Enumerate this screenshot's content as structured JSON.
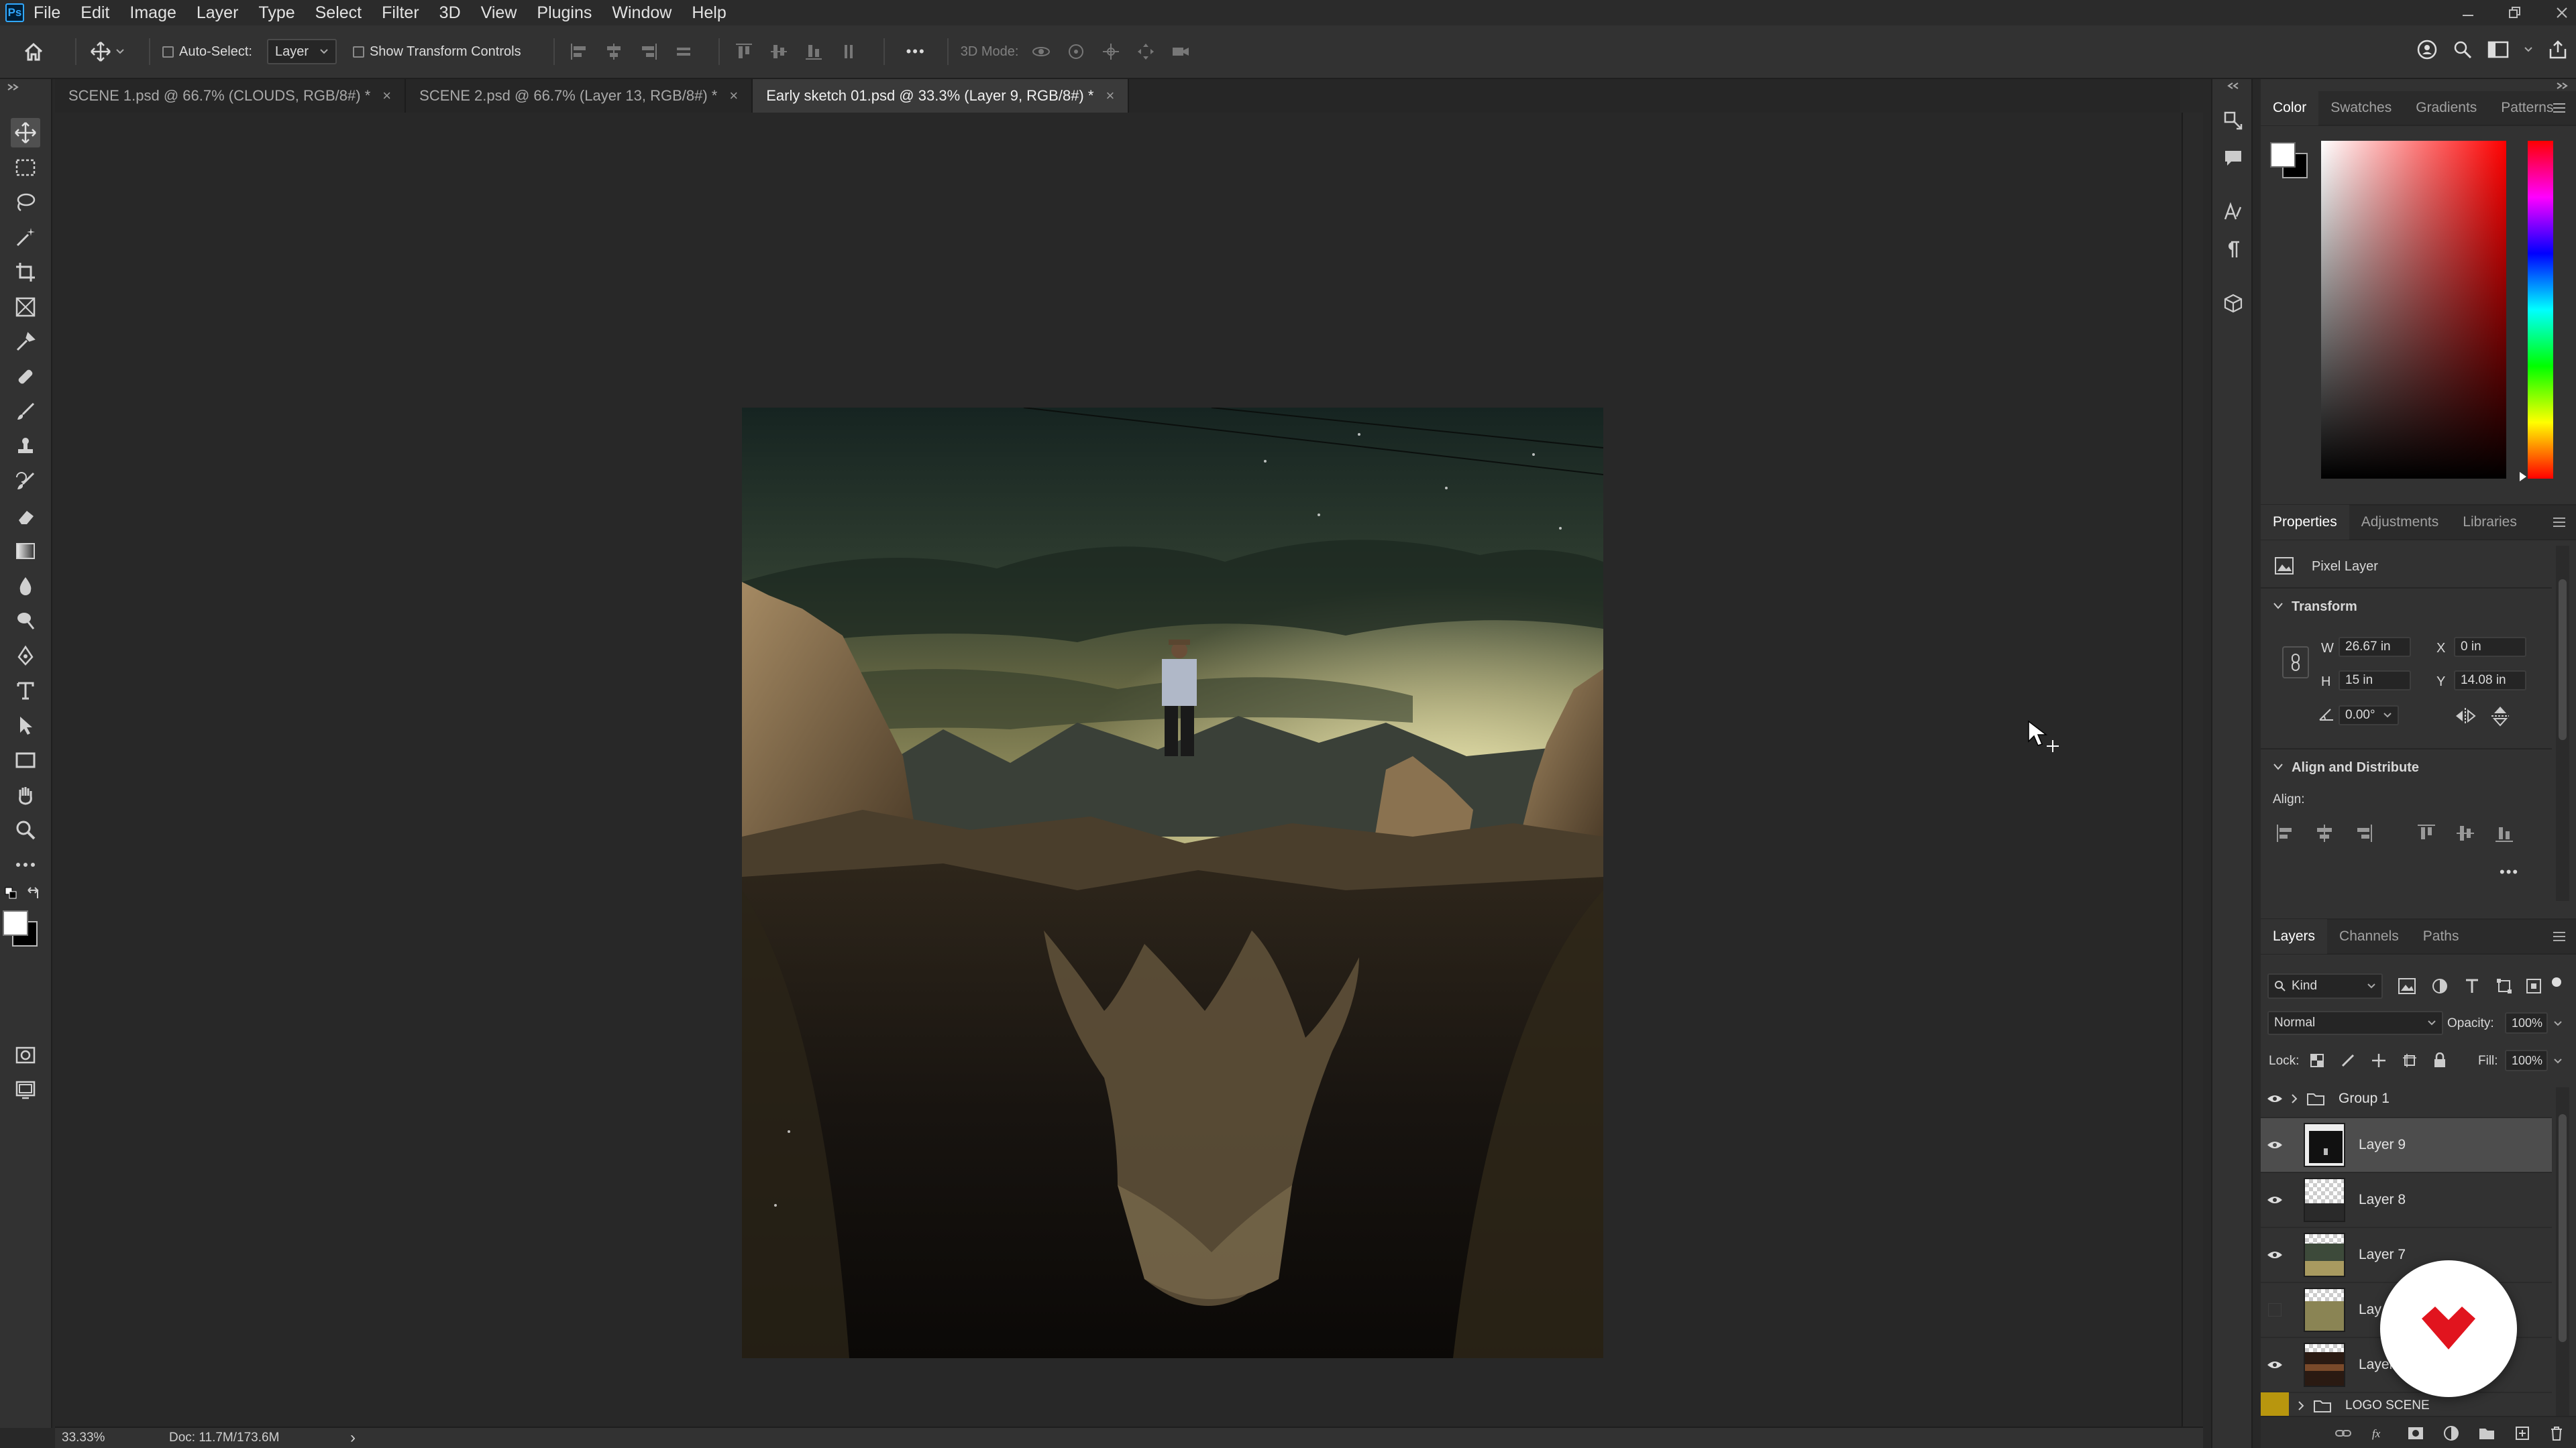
{
  "app": {
    "logo_text": "Ps"
  },
  "menu": [
    "File",
    "Edit",
    "Image",
    "Layer",
    "Type",
    "Select",
    "Filter",
    "3D",
    "View",
    "Plugins",
    "Window",
    "Help"
  ],
  "options_bar": {
    "auto_select_label": "Auto-Select:",
    "auto_select_value": "Layer",
    "show_transform_label": "Show Transform Controls",
    "mode_3d_label": "3D Mode:",
    "more_label": "•••"
  },
  "tabs": [
    {
      "label": "SCENE 1.psd @ 66.7% (CLOUDS, RGB/8#) *",
      "close": "×"
    },
    {
      "label": "SCENE 2.psd @ 66.7% (Layer 13, RGB/8#) *",
      "close": "×"
    },
    {
      "label": "Early sketch 01.psd @ 33.3% (Layer 9, RGB/8#) *",
      "close": "×"
    }
  ],
  "status": {
    "zoom": "33.33%",
    "doc": "Doc: 11.7M/173.6M",
    "arrow": "›"
  },
  "color_panel": {
    "tabs": [
      "Color",
      "Swatches",
      "Gradients",
      "Patterns"
    ],
    "foreground": "#ffffff",
    "background": "#000000",
    "hue": "#ff0000"
  },
  "properties_panel": {
    "tabs": [
      "Properties",
      "Adjustments",
      "Libraries"
    ],
    "layer_kind": "Pixel Layer",
    "transform_title": "Transform",
    "w_label": "W",
    "w_value": "26.67 in",
    "h_label": "H",
    "h_value": "15 in",
    "x_label": "X",
    "x_value": "0 in",
    "y_label": "Y",
    "y_value": "14.08 in",
    "angle_value": "0.00°",
    "align_title": "Align and Distribute",
    "align_label": "Align:",
    "more_label": "•••"
  },
  "layers_panel": {
    "tabs": [
      "Layers",
      "Channels",
      "Paths"
    ],
    "kind_label": "Kind",
    "blend_mode": "Normal",
    "opacity_label": "Opacity:",
    "opacity_value": "100%",
    "lock_label": "Lock:",
    "fill_label": "Fill:",
    "fill_value": "100%",
    "group1": "Group 1",
    "layers": [
      {
        "name": "Layer 9",
        "visible": true,
        "selected": true
      },
      {
        "name": "Layer 8",
        "visible": true,
        "selected": false
      },
      {
        "name": "Layer 7",
        "visible": true,
        "selected": false
      },
      {
        "name": "Lay",
        "visible": false,
        "selected": false
      },
      {
        "name": "Layer",
        "visible": true,
        "selected": false
      }
    ],
    "group_logo": "LOGO SCENE"
  },
  "colors": {
    "accent": "#31a8ff",
    "watermark": "#e1141e",
    "group_tag": "#b8960e"
  }
}
